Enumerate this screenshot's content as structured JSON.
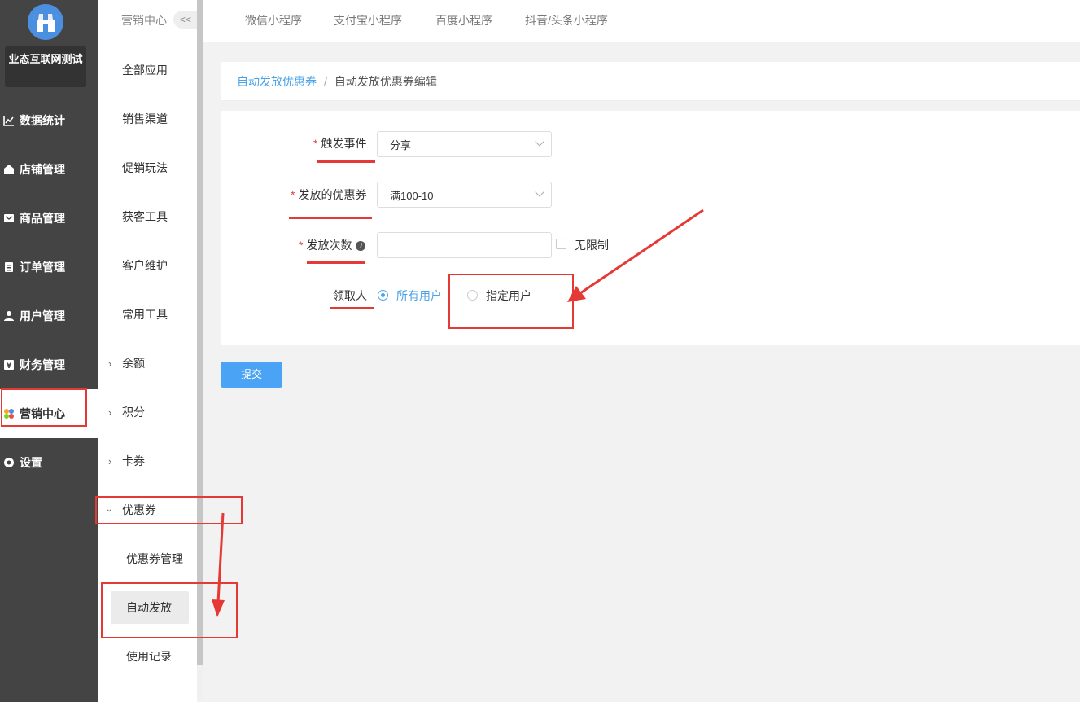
{
  "sidebar": {
    "shop_name": "业态互联网测试",
    "items": [
      {
        "label": "数据统计",
        "icon": "chart-icon"
      },
      {
        "label": "店铺管理",
        "icon": "shop-icon"
      },
      {
        "label": "商品管理",
        "icon": "goods-icon"
      },
      {
        "label": "订单管理",
        "icon": "order-icon"
      },
      {
        "label": "用户管理",
        "icon": "user-icon"
      },
      {
        "label": "财务管理",
        "icon": "finance-icon"
      },
      {
        "label": "营销中心",
        "icon": "marketing-icon"
      },
      {
        "label": "设置",
        "icon": "settings-icon"
      }
    ]
  },
  "submenu": {
    "title": "营销中心",
    "collapse": "<<",
    "items": [
      {
        "label": "全部应用"
      },
      {
        "label": "销售渠道"
      },
      {
        "label": "促销玩法"
      },
      {
        "label": "获客工具"
      },
      {
        "label": "客户维护"
      },
      {
        "label": "常用工具"
      },
      {
        "label": "余额"
      },
      {
        "label": "积分"
      },
      {
        "label": "卡券"
      },
      {
        "label": "优惠券"
      }
    ],
    "children": [
      {
        "label": "优惠券管理"
      },
      {
        "label": "自动发放"
      },
      {
        "label": "使用记录"
      }
    ]
  },
  "tabs": [
    "微信小程序",
    "支付宝小程序",
    "百度小程序",
    "抖音/头条小程序"
  ],
  "breadcrumb": {
    "parent": "自动发放优惠券",
    "separator": "/",
    "current": "自动发放优惠券编辑"
  },
  "form": {
    "required_mark": "*",
    "trigger_label": "触发事件",
    "trigger_value": "分享",
    "coupon_label": "发放的优惠券",
    "coupon_value": "满100-10",
    "count_label": "发放次数",
    "count_value": "",
    "unlimited_label": "无限制",
    "receiver_label": "领取人",
    "receiver_options": [
      "所有用户",
      "指定用户"
    ],
    "receiver_selected": "所有用户"
  },
  "submit_label": "提交",
  "colors": {
    "accent": "#4aa3e8",
    "annotation": "#e53935",
    "sidebar": "#444444"
  }
}
